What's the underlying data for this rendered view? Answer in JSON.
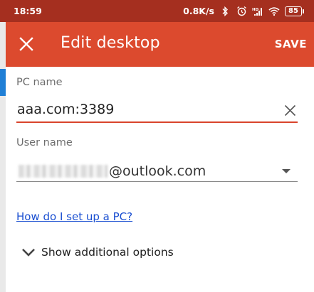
{
  "status_bar": {
    "time": "18:59",
    "network_speed": "0.8K/s",
    "icons": [
      "bluetooth-icon",
      "alarm-icon",
      "hd-signal-icon",
      "wifi-icon"
    ],
    "battery": "85"
  },
  "toolbar": {
    "title": "Edit desktop",
    "save_label": "SAVE",
    "close_icon": "close-icon"
  },
  "form": {
    "pc_name": {
      "label": "PC name",
      "value": "aaa.com:3389"
    },
    "user_name": {
      "label": "User name",
      "value_suffix": "@outlook.com"
    },
    "help_link": "How do I set up a PC?",
    "additional_options": "Show additional options"
  },
  "colors": {
    "status_bar": "#a52f1f",
    "toolbar": "#dc4a2e",
    "accent_underline": "#d9442c",
    "link": "#1a4fd1"
  }
}
